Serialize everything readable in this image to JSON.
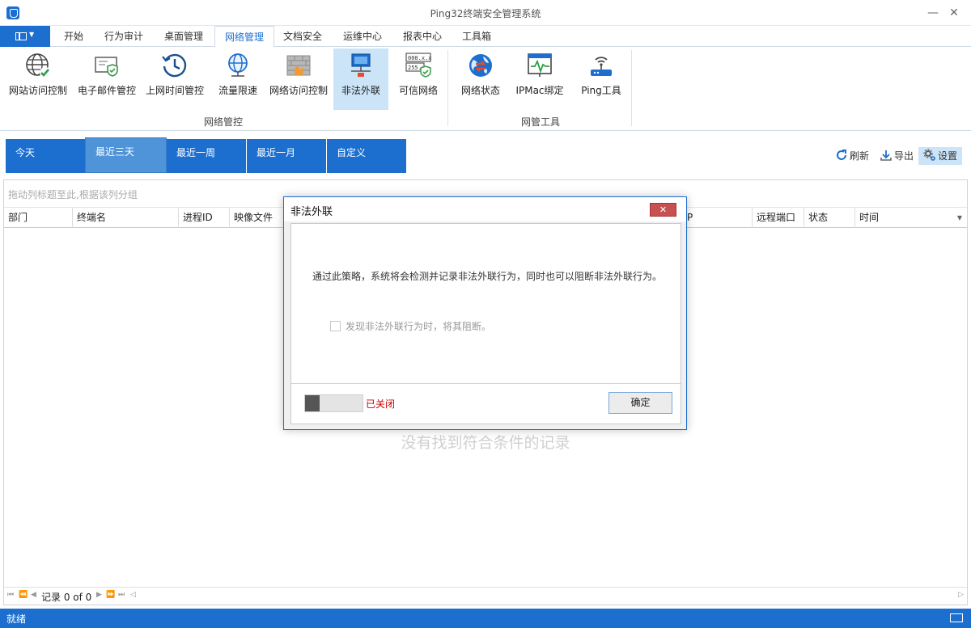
{
  "window": {
    "title": "Ping32终端安全管理系统"
  },
  "menu": {
    "tabs": [
      {
        "label": "开始"
      },
      {
        "label": "行为审计"
      },
      {
        "label": "桌面管理"
      },
      {
        "label": "网络管理",
        "active": true
      },
      {
        "label": "文档安全"
      },
      {
        "label": "运维中心"
      },
      {
        "label": "报表中心"
      },
      {
        "label": "工具箱"
      }
    ]
  },
  "ribbon": {
    "groups": [
      {
        "label": "网络管控"
      },
      {
        "label": "网管工具"
      }
    ],
    "buttons": [
      {
        "label": "网站访问控制",
        "icon": "globe-check-icon"
      },
      {
        "label": "电子邮件管控",
        "icon": "email-shield-icon"
      },
      {
        "label": "上网时间管控",
        "icon": "clock-history-icon"
      },
      {
        "label": "流量限速",
        "icon": "globe-speed-icon"
      },
      {
        "label": "网络访问控制",
        "icon": "firewall-icon"
      },
      {
        "label": "非法外联",
        "icon": "network-computer-icon",
        "active": true
      },
      {
        "label": "可信网络",
        "icon": "ip-shield-icon"
      },
      {
        "label": "网络状态",
        "icon": "earth-arrows-icon"
      },
      {
        "label": "IPMac绑定",
        "icon": "monitor-pulse-icon"
      },
      {
        "label": "Ping工具",
        "icon": "router-signal-icon"
      }
    ]
  },
  "time_filters": [
    {
      "label": "今天"
    },
    {
      "label": "最近三天",
      "selected": true
    },
    {
      "label": "最近一周"
    },
    {
      "label": "最近一月"
    },
    {
      "label": "自定义"
    }
  ],
  "toolbar": {
    "refresh_label": "刷新",
    "export_label": "导出",
    "settings_label": "设置"
  },
  "grid": {
    "group_hint": "拖动列标题至此,根据该列分组",
    "columns": [
      {
        "label": "部门"
      },
      {
        "label": "终端名"
      },
      {
        "label": "进程ID"
      },
      {
        "label": "映像文件"
      },
      {
        "label": "P"
      },
      {
        "label": "远程端口"
      },
      {
        "label": "状态"
      },
      {
        "label": "时间"
      }
    ],
    "empty_message": "没有找到符合条件的记录",
    "pager_text": "记录 0 of 0"
  },
  "dialog": {
    "title": "非法外联",
    "close_label": "✕",
    "description": "通过此策略，系统将会检测并记录非法外联行为，同时也可以阻断非法外联行为。",
    "checkbox_label": "发现非法外联行为时，将其阻断。",
    "switch_state": "已关闭",
    "ok_label": "确定"
  },
  "status": {
    "text": "就绪"
  },
  "colors": {
    "accent": "#1c6fcf",
    "selected_tile": "#4f93d9",
    "ribbon_active": "#cce4f7",
    "off_text": "#cc0000"
  }
}
